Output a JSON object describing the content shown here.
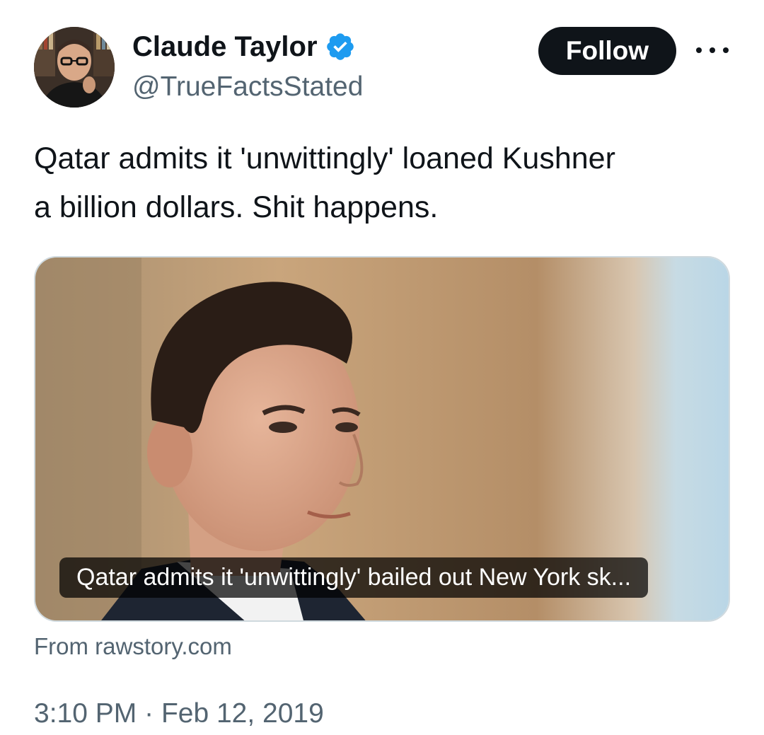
{
  "author": {
    "display_name": "Claude Taylor",
    "handle": "@TrueFactsStated",
    "verified_icon": "verified-badge-icon",
    "verified_color": "#1d9bf0"
  },
  "follow_button": {
    "label": "Follow"
  },
  "more_menu": {
    "icon": "more-horizontal-icon"
  },
  "tweet": {
    "text_line1": "Qatar admits it 'unwittingly' loaned Kushner",
    "text_line2": "a billion dollars. Shit happens."
  },
  "link_card": {
    "caption": "Qatar admits it 'unwittingly' bailed out New York sk...",
    "source": "From rawstory.com"
  },
  "meta": {
    "time": "3:10 PM",
    "separator": "·",
    "date": "Feb 12, 2019"
  },
  "colors": {
    "text_primary": "#0f1419",
    "text_secondary": "#536471",
    "card_border": "#cfd9de",
    "accent": "#1d9bf0"
  }
}
